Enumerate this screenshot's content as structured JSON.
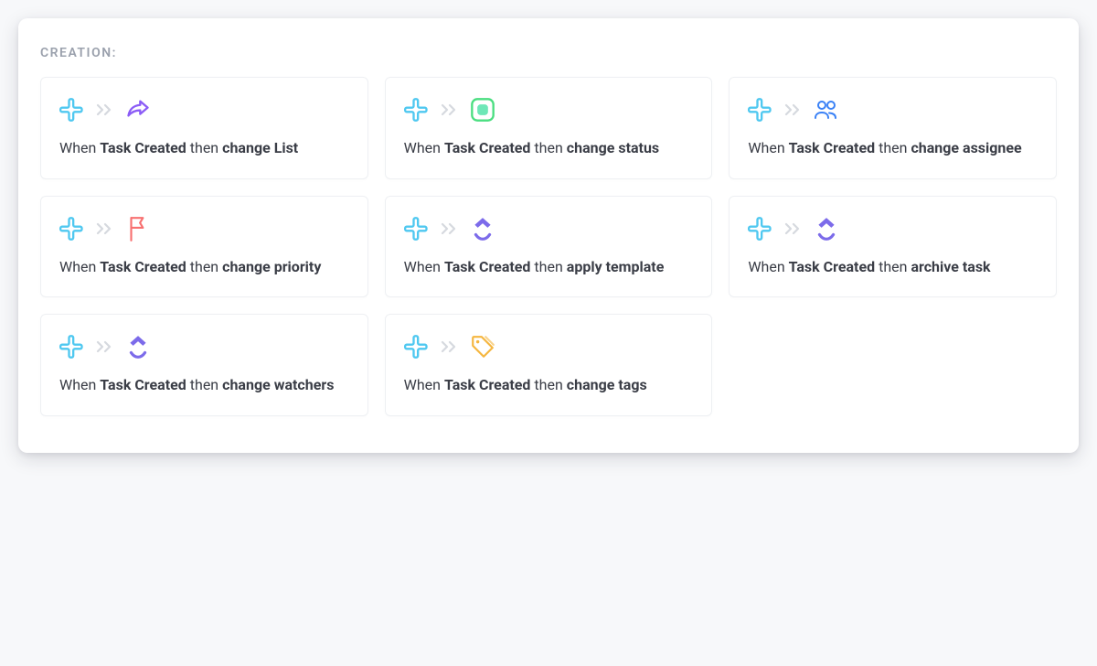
{
  "section_title": "CREATION:",
  "colors": {
    "plus": "#4fc8f0",
    "chevrons": "#d6d9df",
    "share": "#8b5cf6",
    "status_border": "#4ade80",
    "status_fill": "#6ee7b7",
    "people": "#3b82f6",
    "flag": "#f87171",
    "clickup": "#7c6bea",
    "tag": "#f5b63f"
  },
  "common": {
    "prefix": "When ",
    "trigger": "Task Created",
    "middle": " then "
  },
  "cards": [
    {
      "action": "change List",
      "icon": "share"
    },
    {
      "action": "change status",
      "icon": "status"
    },
    {
      "action": "change assignee",
      "icon": "people"
    },
    {
      "action": "change priority",
      "icon": "flag"
    },
    {
      "action": "apply template",
      "icon": "clickup"
    },
    {
      "action": "archive task",
      "icon": "clickup"
    },
    {
      "action": "change watchers",
      "icon": "clickup"
    },
    {
      "action": "change tags",
      "icon": "tag"
    }
  ]
}
